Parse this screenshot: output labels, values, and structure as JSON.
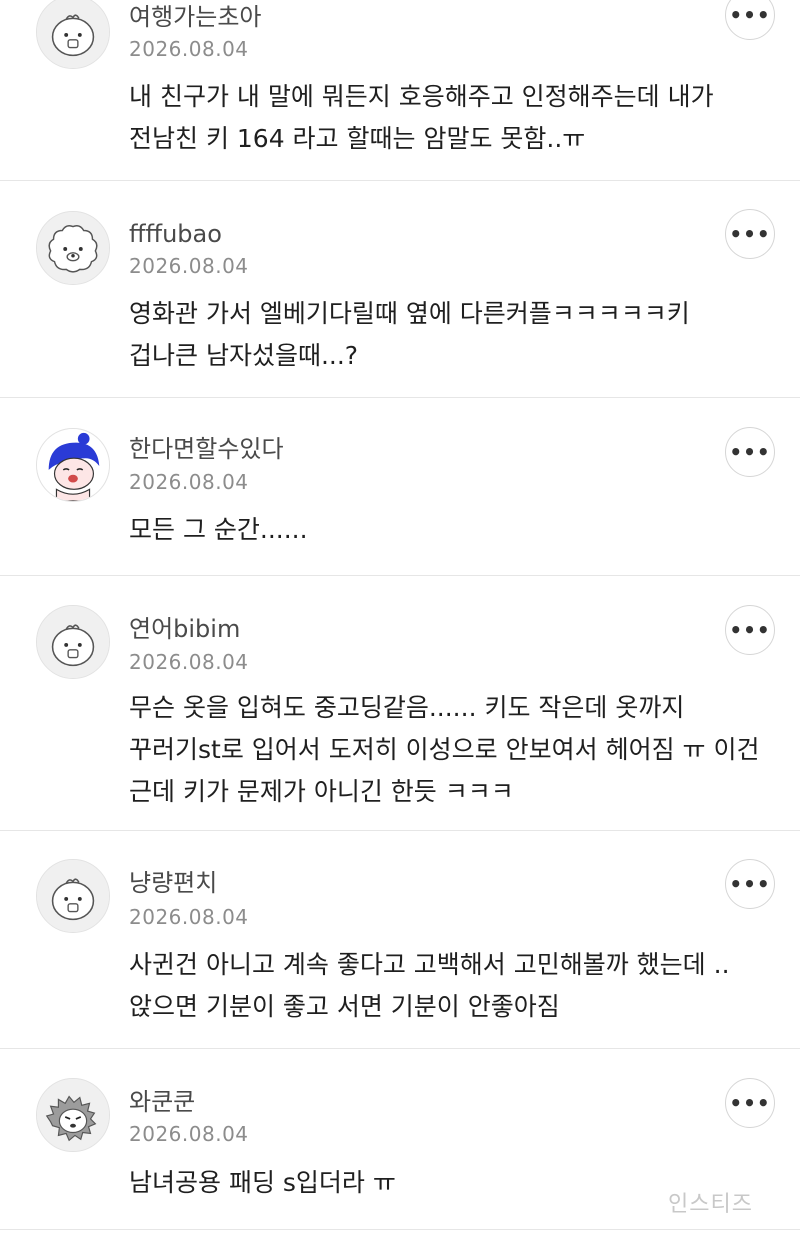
{
  "comments": [
    {
      "username": "여행가는초아",
      "date": "2026.08.04",
      "text": "내 친구가 내 말에 뭐든지 호응해주고 인정해주는데 내가 전남친 키 164 라고 할때는 암말도 못함..ㅠ",
      "avatar_icon": "blob-face-icon"
    },
    {
      "username": "ffffubao",
      "date": "2026.08.04",
      "text": "영화관 가서 엘베기다릴때 옆에 다른커플ㅋㅋㅋㅋㅋ키 겁나큰 남자섰을때...?",
      "avatar_icon": "fluffy-dog-icon"
    },
    {
      "username": "한다면할수있다",
      "date": "2026.08.04",
      "text": "모든 그 순간......",
      "avatar_icon": "blue-hair-character-icon"
    },
    {
      "username": "연어bibim",
      "date": "2026.08.04",
      "text": "무슨 옷을 입혀도 중고딩같음...... 키도 작은데 옷까지 꾸러기st로 입어서 도저히 이성으로 안보여서 헤어짐 ㅠ 이건 근데 키가 문제가 아니긴 한듯 ㅋㅋㅋ",
      "avatar_icon": "blob-face-icon"
    },
    {
      "username": "냥량편치",
      "date": "2026.08.04",
      "text": "사귄건 아니고 계속 좋다고 고백해서 고민해볼까 했는데 .. 앉으면 기분이 좋고 서면 기분이 안좋아짐",
      "avatar_icon": "blob-face-icon"
    },
    {
      "username": "와쿤쿤",
      "date": "2026.08.04",
      "text": "남녀공용 패딩 s입더라 ㅠ",
      "avatar_icon": "spiky-hedgehog-icon"
    }
  ],
  "more_button_icon": "more-dots-icon",
  "more_button_glyph": "•••",
  "watermark_text": "인스티즈"
}
